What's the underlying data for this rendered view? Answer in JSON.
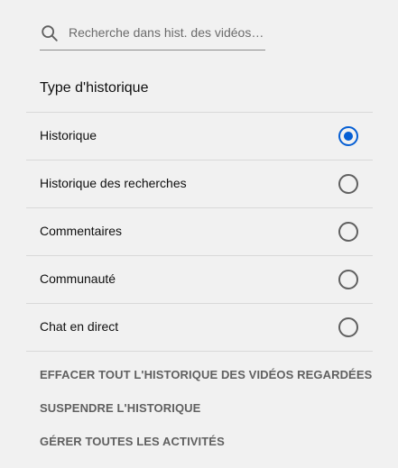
{
  "search": {
    "placeholder": "Recherche dans hist. des vidéos r...",
    "icon": "search-icon"
  },
  "section_title": "Type d'historique",
  "history_types": [
    {
      "label": "Historique",
      "checked": true
    },
    {
      "label": "Historique des recherches",
      "checked": false
    },
    {
      "label": "Commentaires",
      "checked": false
    },
    {
      "label": "Communauté",
      "checked": false
    },
    {
      "label": "Chat en direct",
      "checked": false
    }
  ],
  "actions": [
    "EFFACER TOUT L'HISTORIQUE DES VIDÉOS REGARDÉES",
    "SUSPENDRE L'HISTORIQUE",
    "GÉRER TOUTES LES ACTIVITÉS"
  ],
  "colors": {
    "accent": "#065fd4",
    "background": "#f1f1f1",
    "action_text": "#606060"
  }
}
